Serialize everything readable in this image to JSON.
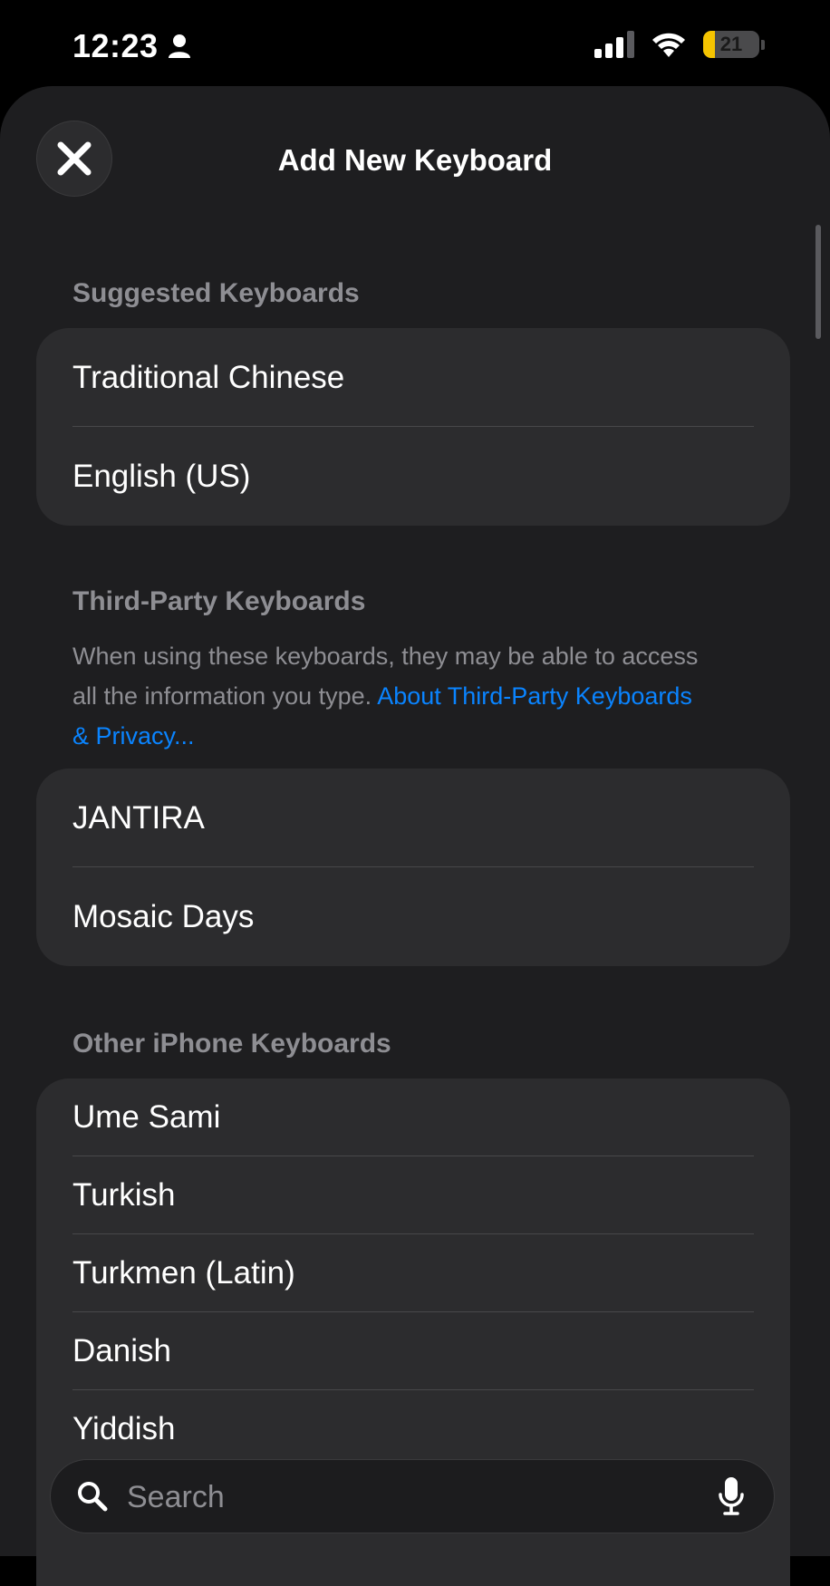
{
  "status_bar": {
    "time": "12:23",
    "battery_percent": "21",
    "battery_level": 0.21
  },
  "header": {
    "title": "Add New Keyboard"
  },
  "suggested": {
    "header": "Suggested Keyboards",
    "items": [
      {
        "label": "Traditional Chinese"
      },
      {
        "label": "English (US)"
      }
    ]
  },
  "third_party": {
    "header": "Third-Party Keyboards",
    "note": "When using these keyboards, they may be able to access all the information you type.",
    "link": "About Third-Party Keyboards & Privacy...",
    "items": [
      {
        "label": "JANTIRA"
      },
      {
        "label": "Mosaic Days"
      }
    ]
  },
  "other": {
    "header": "Other iPhone Keyboards",
    "items": [
      {
        "label": "Ume Sami"
      },
      {
        "label": "Turkish"
      },
      {
        "label": "Turkmen (Latin)"
      },
      {
        "label": "Danish"
      },
      {
        "label": "Yiddish"
      }
    ]
  },
  "search": {
    "placeholder": "Search"
  },
  "icons": {
    "person": "person-icon",
    "signal": "cellular-signal-icon",
    "wifi": "wifi-icon",
    "close": "close-icon",
    "search": "search-icon",
    "mic": "microphone-icon"
  },
  "colors": {
    "accent_link": "#0a84ff",
    "battery_low": "#f5c400"
  }
}
